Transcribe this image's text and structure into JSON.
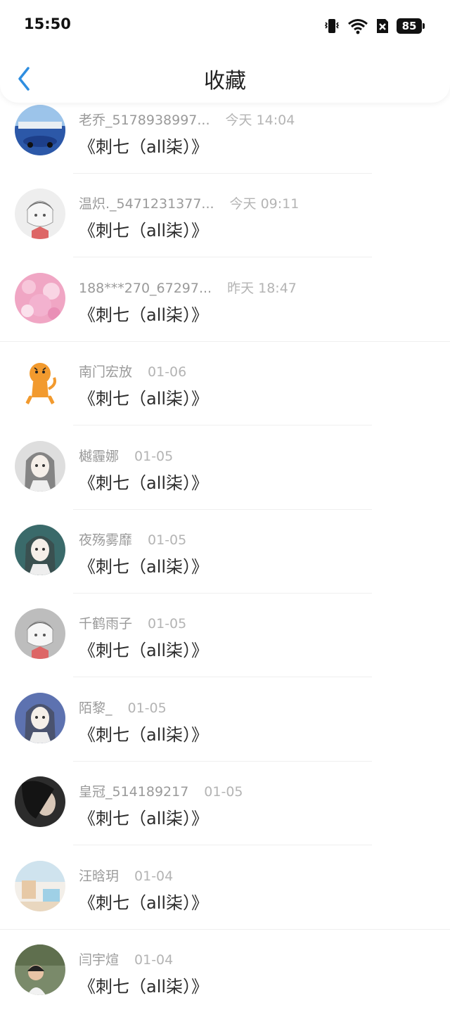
{
  "status_bar": {
    "time": "15:50",
    "battery": "85"
  },
  "header": {
    "title": "收藏"
  },
  "items": [
    {
      "user": "老乔_5178938997...",
      "date": "今天 14:04",
      "book": "《刺七（all柒）》",
      "avatar": "car-icon",
      "color": "#2c58a8"
    },
    {
      "user": "温炽._5471231377...",
      "date": "今天 09:11",
      "book": "《刺七（all柒）》",
      "avatar": "anime-boy-icon",
      "color": "#eeeeee"
    },
    {
      "user": "188***270_67297...",
      "date": "昨天 18:47",
      "book": "《刺七（all柒）》",
      "avatar": "pink-girl-icon",
      "color": "#f0a6c4"
    },
    {
      "user": "南门宏放",
      "date": "01-06",
      "book": "《刺七（all柒）》",
      "avatar": "tiger-icon",
      "color": "#f29a2e"
    },
    {
      "user": "樾霾娜",
      "date": "01-05",
      "book": "《刺七（all柒）》",
      "avatar": "anime-girl-icon",
      "color": "#dedede"
    },
    {
      "user": "夜殇雾靡",
      "date": "01-05",
      "book": "《刺七（all柒）》",
      "avatar": "anime-girl-icon",
      "color": "#3a6a6a"
    },
    {
      "user": "千鹤雨子",
      "date": "01-05",
      "book": "《刺七（all柒）》",
      "avatar": "anime-boy-icon",
      "color": "#bdbdbd"
    },
    {
      "user": "陌黎_",
      "date": "01-05",
      "book": "《刺七（all柒）》",
      "avatar": "anime-girl-icon",
      "color": "#5d72b0"
    },
    {
      "user": "皇冠_514189217",
      "date": "01-05",
      "book": "《刺七（all柒）》",
      "avatar": "portrait-icon",
      "color": "#2c2c2c"
    },
    {
      "user": "汪晗玥",
      "date": "01-04",
      "book": "《刺七（all柒）》",
      "avatar": "room-icon",
      "color": "#e7c9a6"
    },
    {
      "user": "闫宇煊",
      "date": "01-04",
      "book": "《刺七（all柒）》",
      "avatar": "child-photo-icon",
      "color": "#7a8a6a"
    }
  ]
}
